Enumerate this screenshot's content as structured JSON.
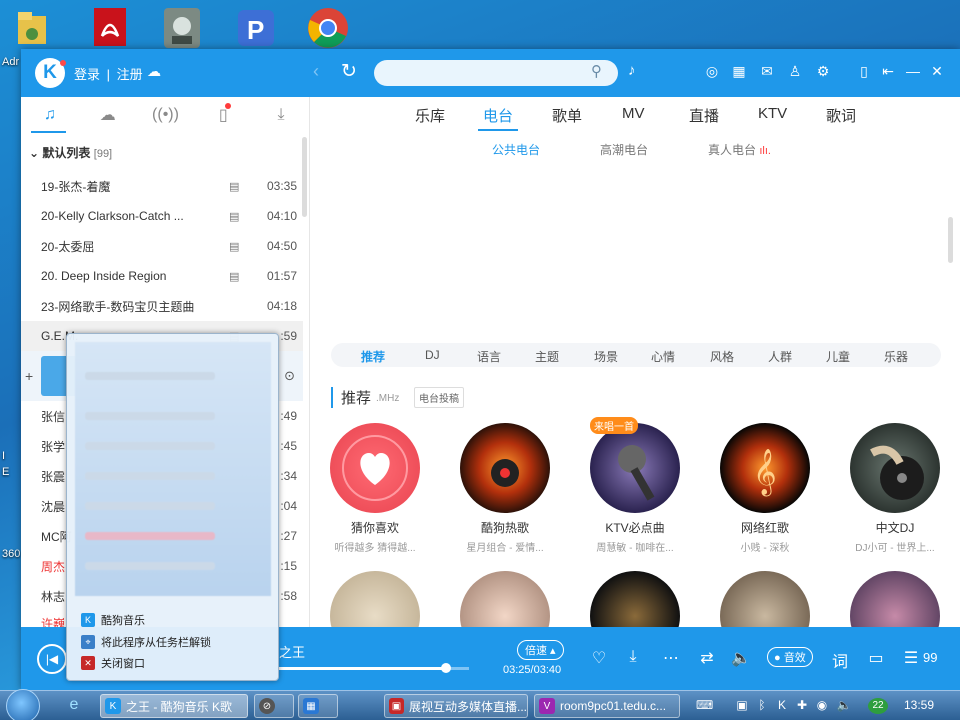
{
  "header": {
    "logo": "K",
    "login": "登录",
    "register": "注册",
    "separator": "|"
  },
  "search": {
    "placeholder": ""
  },
  "sidebar": {
    "playlist_name": "默认列表",
    "playlist_count": "[99]",
    "tracks": [
      {
        "name": "19-张杰-着魔",
        "mv": true,
        "duration": "03:35"
      },
      {
        "name": "20-Kelly Clarkson-Catch ...",
        "mv": true,
        "duration": "04:10"
      },
      {
        "name": "20-太委屈",
        "mv": true,
        "duration": "04:50"
      },
      {
        "name": "20. Deep Inside Region",
        "mv": true,
        "duration": "01:57"
      },
      {
        "name": "23-网络歌手-数码宝贝主题曲",
        "mv": false,
        "duration": "04:18"
      },
      {
        "name": "G.E.M.",
        "mv": true,
        "duration": ":59"
      }
    ],
    "partial_tracks": [
      {
        "name": "张信",
        "duration": ":49"
      },
      {
        "name": "张学",
        "duration": ":45"
      },
      {
        "name": "张震",
        "duration": ":34"
      },
      {
        "name": "沈晨",
        "duration": ":04"
      },
      {
        "name": "MC阿",
        "duration": ":27"
      },
      {
        "name": "周杰",
        "duration": ":15"
      },
      {
        "name": "林志",
        "duration": ":58"
      },
      {
        "name": "许巍",
        "duration": ""
      }
    ]
  },
  "main_tabs": [
    "乐库",
    "电台",
    "歌单",
    "MV",
    "直播",
    "KTV",
    "歌词"
  ],
  "active_main_tab": "电台",
  "sub_tabs": [
    "公共电台",
    "高潮电台",
    "真人电台"
  ],
  "categories": [
    "推荐",
    "DJ",
    "语言",
    "主题",
    "场景",
    "心情",
    "风格",
    "人群",
    "儿童",
    "乐器"
  ],
  "recommend": {
    "title": "推荐",
    "unit": ".MHz",
    "submit_label": "电台投稿",
    "stations": [
      {
        "title": "猜你喜欢",
        "sub": "听得越多 猜得越..."
      },
      {
        "title": "酷狗热歌",
        "sub": "星月组合 - 爱情..."
      },
      {
        "title": "KTV必点曲",
        "sub": "周慧敏 - 咖啡在...",
        "badge": "来唱一首"
      },
      {
        "title": "网络红歌",
        "sub": "小贱 - 深秋"
      },
      {
        "title": "中文DJ",
        "sub": "DJ小可 - 世界上..."
      }
    ]
  },
  "player": {
    "now_playing": "之王",
    "speed_label": "倍速",
    "time": "03:25/03:40",
    "progress": 0.88,
    "sound_label": "音效",
    "lyrics_label": "词",
    "playlist_count": "99"
  },
  "jump_list": {
    "items": [
      "酷狗音乐",
      "将此程序从任务栏解锁",
      "关闭窗口"
    ]
  },
  "taskbar": {
    "buttons": [
      {
        "label": "之王 - 酷狗音乐 K歌",
        "active": true
      },
      {
        "label": "",
        "active": false
      },
      {
        "label": "",
        "active": false
      },
      {
        "label": "展视互动多媒体直播...",
        "active": false
      },
      {
        "label": "room9pc01.tedu.c...",
        "active": false
      }
    ],
    "tray_badge": "22",
    "clock": "13:59"
  },
  "desktop": {
    "labels": [
      "Adr",
      "I",
      "E",
      "360"
    ]
  },
  "colors": {
    "accent": "#1f98ea",
    "red": "#ff3b3b",
    "badge": "#ff8c1a"
  }
}
